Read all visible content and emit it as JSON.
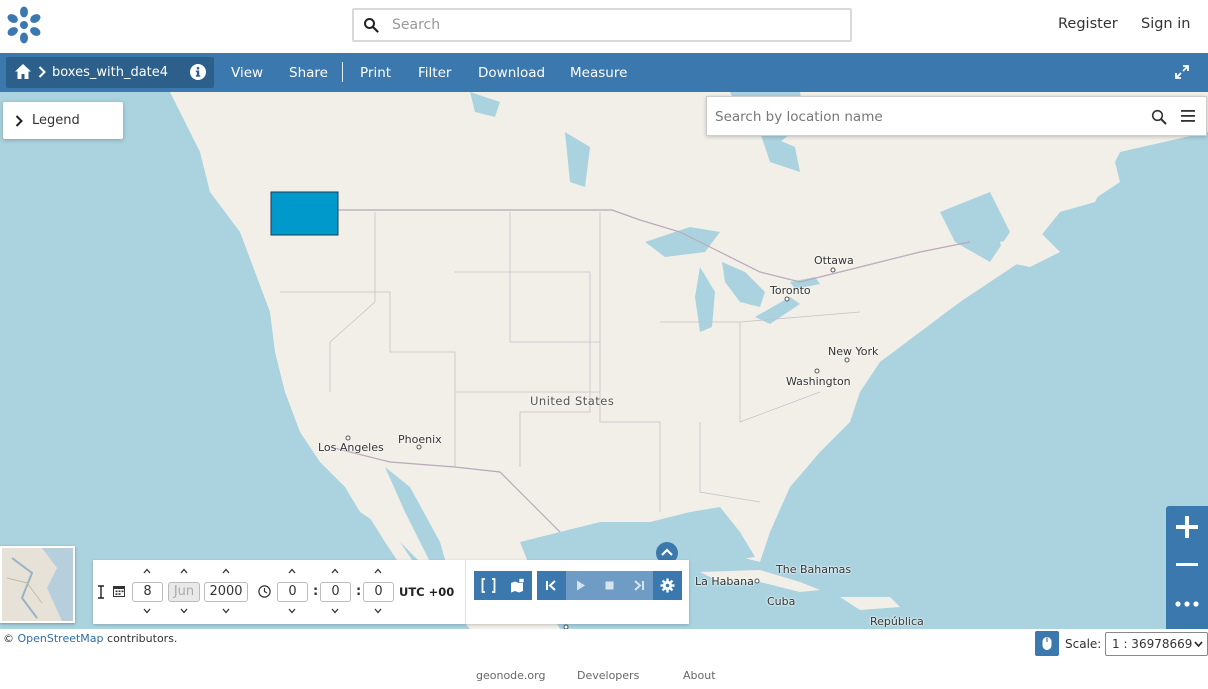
{
  "header": {
    "search_placeholder": "Search",
    "register_label": "Register",
    "signin_label": "Sign in"
  },
  "toolbar": {
    "layer_title": "boxes_with_date4",
    "menu": [
      "View",
      "Share",
      "Print",
      "Filter",
      "Download",
      "Measure"
    ]
  },
  "map": {
    "legend_label": "Legend",
    "location_search_placeholder": "Search by location name",
    "cities": [
      "Ottawa",
      "Toronto",
      "New York",
      "Washington",
      "Los Angeles",
      "Phoenix",
      "La Habana",
      "The Bahamas",
      "Cuba",
      "República"
    ],
    "country_label": "United States",
    "feature_color": "#0099cc"
  },
  "time_control": {
    "day": "8",
    "month": "Jun",
    "year": "2000",
    "hour": "0",
    "minute": "0",
    "second": "0",
    "timezone": "UTC +00"
  },
  "footer": {
    "attribution_prefix": "©",
    "attribution_link": "OpenStreetMap",
    "attribution_suffix": "contributors.",
    "scale_label": "Scale:",
    "scale_value": "1 : 36978669",
    "links": [
      "geonode.org",
      "Developers",
      "About"
    ]
  },
  "colors": {
    "accent": "#3a78ad",
    "water": "#aad3df",
    "land": "#f2efe9"
  }
}
